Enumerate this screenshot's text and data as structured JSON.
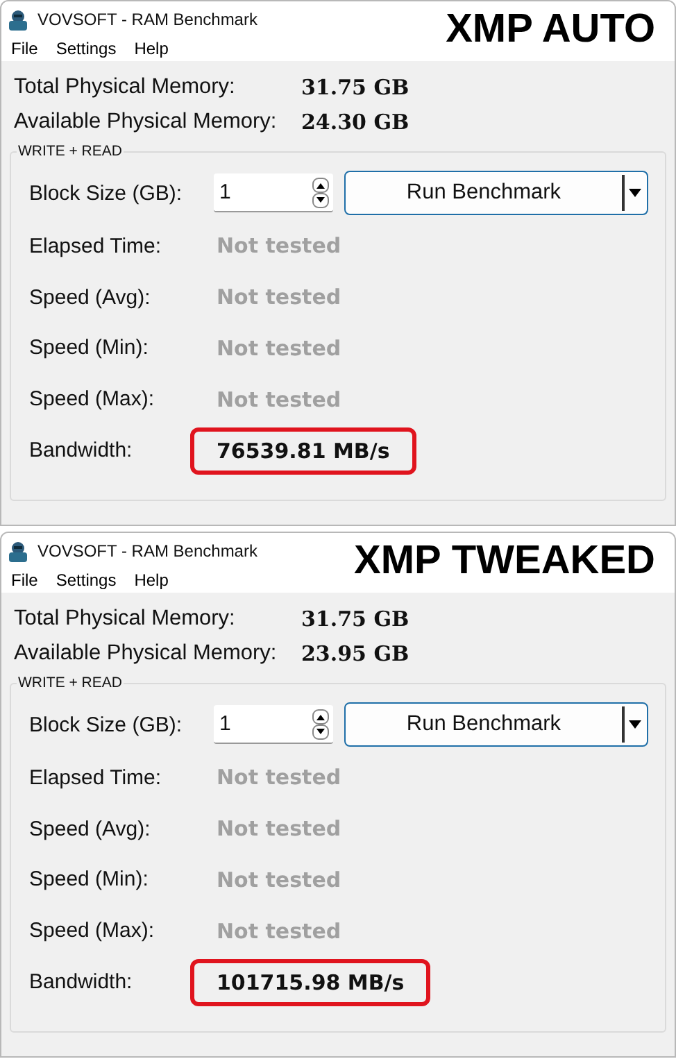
{
  "windows": [
    {
      "title": "VOVSOFT - RAM Benchmark",
      "caption": "XMP AUTO",
      "menu": [
        "File",
        "Settings",
        "Help"
      ],
      "memory": [
        {
          "label": "Total Physical Memory:",
          "value": "31.75 GB"
        },
        {
          "label": "Available Physical Memory:",
          "value": "24.30 GB"
        }
      ],
      "group": {
        "title": "WRITE + READ",
        "rows": [
          {
            "kind": "input",
            "label": "Block Size (GB):",
            "value": "1",
            "button": "Run Benchmark"
          },
          {
            "kind": "result",
            "label": "Elapsed Time:",
            "value": "Not tested",
            "disabled": true,
            "highlighted": false
          },
          {
            "kind": "result",
            "label": "Speed (Avg):",
            "value": "Not tested",
            "disabled": true,
            "highlighted": false
          },
          {
            "kind": "result",
            "label": "Speed (Min):",
            "value": "Not tested",
            "disabled": true,
            "highlighted": false
          },
          {
            "kind": "result",
            "label": "Speed (Max):",
            "value": "Not tested",
            "disabled": true,
            "highlighted": false
          },
          {
            "kind": "result",
            "label": "Bandwidth:",
            "value": "76539.81 MB/s",
            "disabled": false,
            "highlighted": true
          }
        ]
      }
    },
    {
      "title": "VOVSOFT - RAM Benchmark",
      "caption": "XMP TWEAKED",
      "menu": [
        "File",
        "Settings",
        "Help"
      ],
      "memory": [
        {
          "label": "Total Physical Memory:",
          "value": "31.75 GB"
        },
        {
          "label": "Available Physical Memory:",
          "value": "23.95 GB"
        }
      ],
      "group": {
        "title": "WRITE + READ",
        "rows": [
          {
            "kind": "input",
            "label": "Block Size (GB):",
            "value": "1",
            "button": "Run Benchmark"
          },
          {
            "kind": "result",
            "label": "Elapsed Time:",
            "value": "Not tested",
            "disabled": true,
            "highlighted": false
          },
          {
            "kind": "result",
            "label": "Speed (Avg):",
            "value": "Not tested",
            "disabled": true,
            "highlighted": false
          },
          {
            "kind": "result",
            "label": "Speed (Min):",
            "value": "Not tested",
            "disabled": true,
            "highlighted": false
          },
          {
            "kind": "result",
            "label": "Speed (Max):",
            "value": "Not tested",
            "disabled": true,
            "highlighted": false
          },
          {
            "kind": "result",
            "label": "Bandwidth:",
            "value": "101715.98 MB/s",
            "disabled": false,
            "highlighted": true
          }
        ]
      }
    }
  ]
}
